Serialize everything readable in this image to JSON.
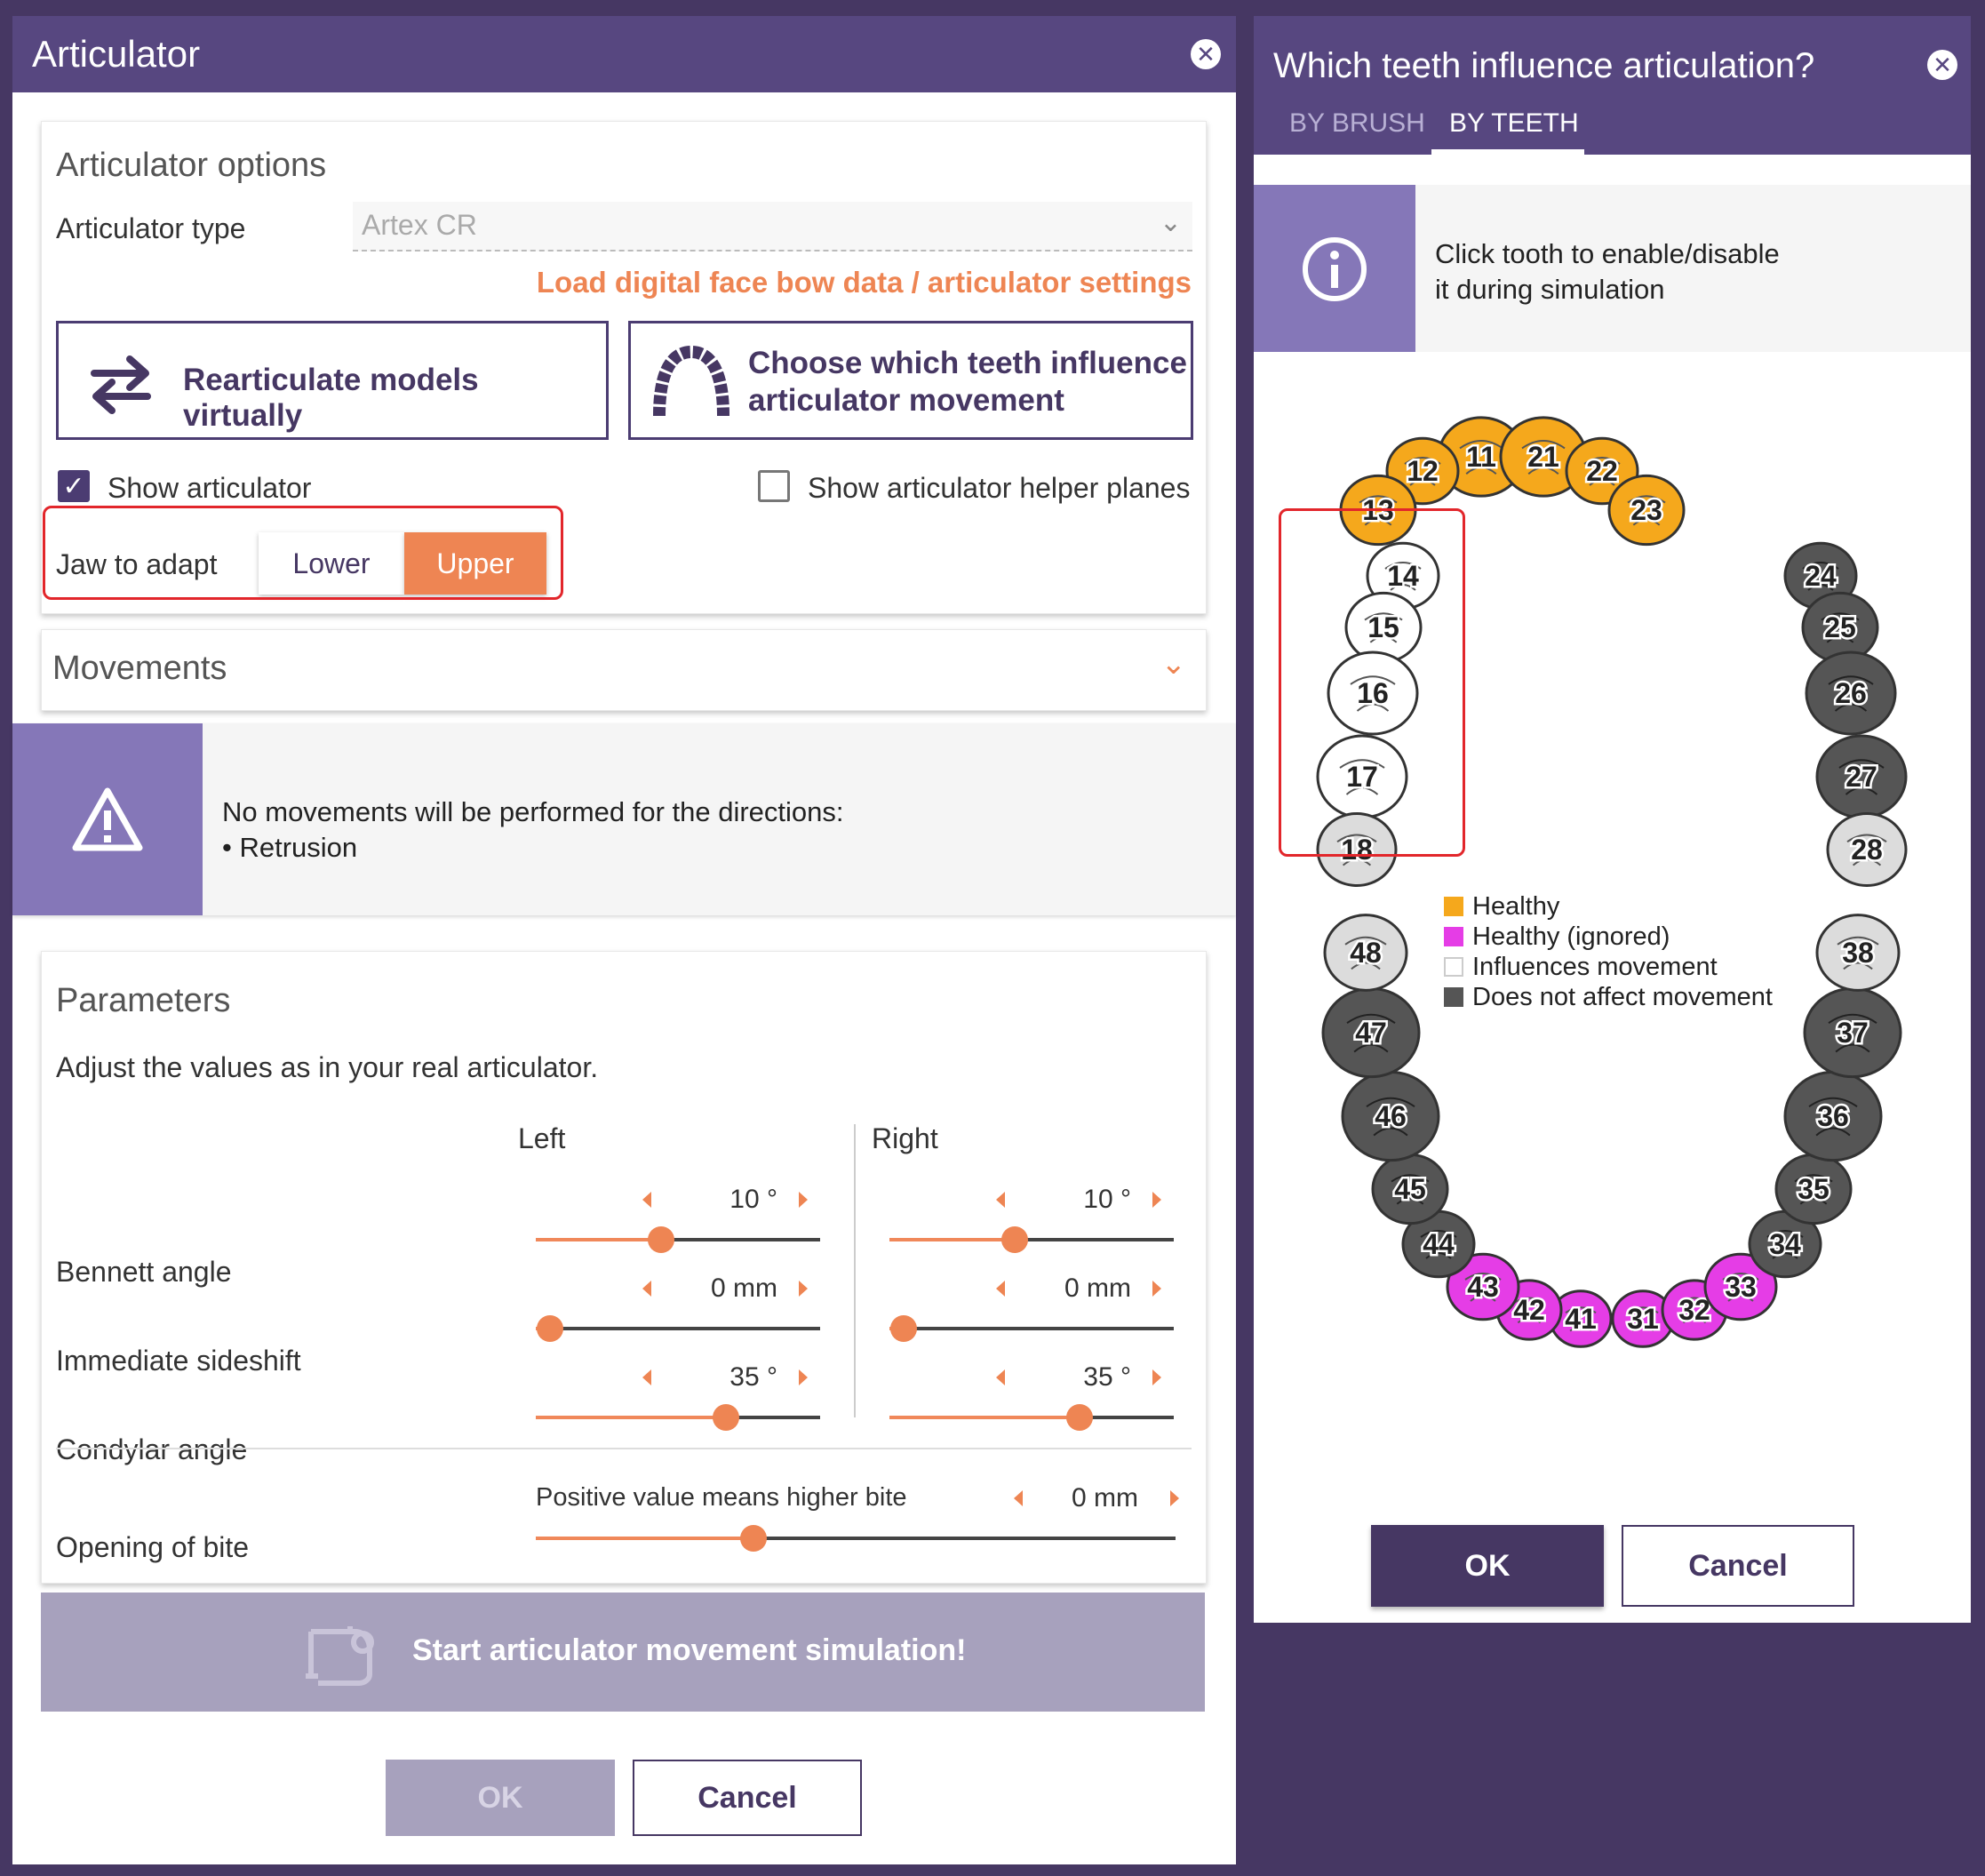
{
  "left_dialog": {
    "title": "Articulator",
    "options": {
      "title": "Articulator options",
      "type_label": "Articulator type",
      "type_value": "Artex CR",
      "load_link": "Load digital face bow data / articulator settings",
      "rearticulate_label": "Rearticulate models virtually",
      "choose_teeth_label_1": "Choose which teeth influence",
      "choose_teeth_label_2": "articulator movement",
      "show_articulator": "Show articulator",
      "show_helper_planes": "Show articulator helper planes",
      "jaw_label": "Jaw to adapt",
      "jaw_lower": "Lower",
      "jaw_upper": "Upper"
    },
    "movements": {
      "title": "Movements"
    },
    "warning": {
      "line1": "No movements will be performed for the directions:",
      "line2": "• Retrusion"
    },
    "parameters": {
      "title": "Parameters",
      "description": "Adjust the values as in your real articulator.",
      "left_header": "Left",
      "right_header": "Right",
      "rows": [
        {
          "label": "Bennett angle",
          "left_value": "10 °",
          "right_value": "10 °",
          "left_pos": 0.44,
          "right_pos": 0.44
        },
        {
          "label": "Immediate sideshift",
          "left_value": "0 mm",
          "right_value": "0 mm",
          "left_pos": 0.05,
          "right_pos": 0.05
        },
        {
          "label": "Condylar angle",
          "left_value": "35 °",
          "right_value": "35 °",
          "left_pos": 0.67,
          "right_pos": 0.67
        }
      ],
      "bite_hint": "Positive value means higher bite",
      "bite_label": "Opening of bite",
      "bite_value": "0 mm",
      "bite_pos": 0.34
    },
    "start_label": "Start articulator movement simulation!",
    "ok": "OK",
    "cancel": "Cancel"
  },
  "right_dialog": {
    "title": "Which teeth influence articulation?",
    "tabs": [
      {
        "label": "BY BRUSH"
      },
      {
        "label": "BY TEETH"
      }
    ],
    "info_line1": "Click tooth to enable/disable",
    "info_line2": "it during simulation",
    "legend": [
      {
        "label": "Healthy",
        "color": "#f5a81c"
      },
      {
        "label": "Healthy (ignored)",
        "color": "#e53de6"
      },
      {
        "label": "Influences movement",
        "color": "#ffffff"
      },
      {
        "label": "Does not affect movement",
        "color": "#555555"
      }
    ],
    "teeth": [
      {
        "num": "11",
        "state": "healthy"
      },
      {
        "num": "12",
        "state": "healthy"
      },
      {
        "num": "13",
        "state": "healthy"
      },
      {
        "num": "14",
        "state": "influences"
      },
      {
        "num": "15",
        "state": "influences"
      },
      {
        "num": "16",
        "state": "influences"
      },
      {
        "num": "17",
        "state": "influences"
      },
      {
        "num": "18",
        "state": "missing"
      },
      {
        "num": "21",
        "state": "healthy"
      },
      {
        "num": "22",
        "state": "healthy"
      },
      {
        "num": "23",
        "state": "healthy"
      },
      {
        "num": "24",
        "state": "no_effect"
      },
      {
        "num": "25",
        "state": "no_effect"
      },
      {
        "num": "26",
        "state": "no_effect"
      },
      {
        "num": "27",
        "state": "no_effect"
      },
      {
        "num": "28",
        "state": "missing"
      },
      {
        "num": "31",
        "state": "ignored"
      },
      {
        "num": "32",
        "state": "ignored"
      },
      {
        "num": "33",
        "state": "ignored"
      },
      {
        "num": "34",
        "state": "no_effect"
      },
      {
        "num": "35",
        "state": "no_effect"
      },
      {
        "num": "36",
        "state": "no_effect"
      },
      {
        "num": "37",
        "state": "no_effect"
      },
      {
        "num": "38",
        "state": "missing"
      },
      {
        "num": "41",
        "state": "ignored"
      },
      {
        "num": "42",
        "state": "ignored"
      },
      {
        "num": "43",
        "state": "ignored"
      },
      {
        "num": "44",
        "state": "no_effect"
      },
      {
        "num": "45",
        "state": "no_effect"
      },
      {
        "num": "46",
        "state": "no_effect"
      },
      {
        "num": "47",
        "state": "no_effect"
      },
      {
        "num": "48",
        "state": "missing"
      }
    ],
    "ok": "OK",
    "cancel": "Cancel"
  }
}
